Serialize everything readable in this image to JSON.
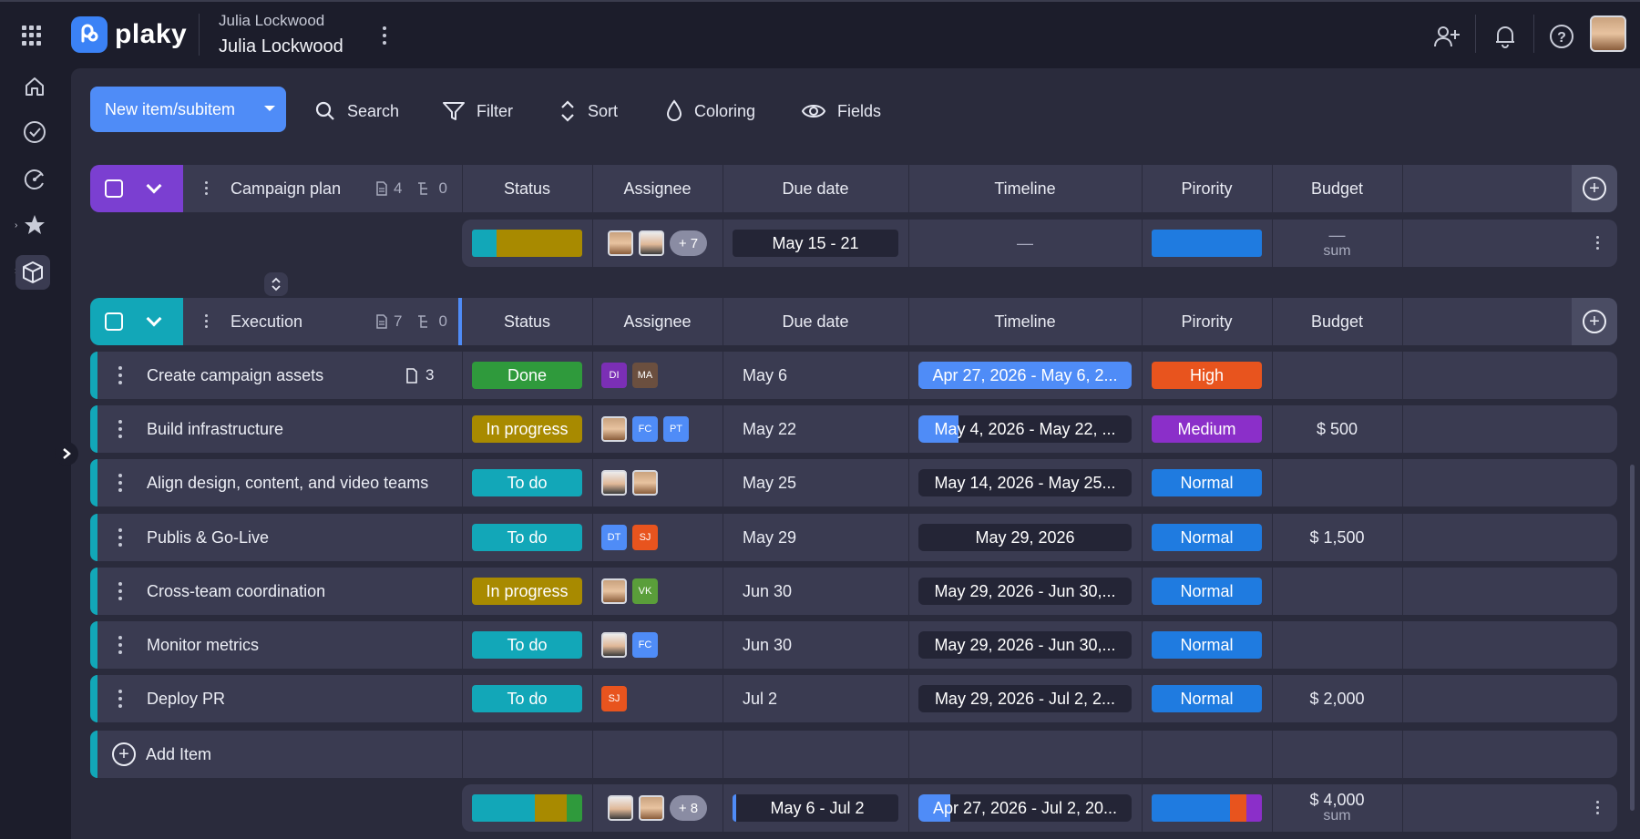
{
  "app": {
    "brand": "plaky",
    "workspace_owner": "Julia Lockwood",
    "board_title": "Julia Lockwood"
  },
  "toolbar": {
    "new_label": "New item/subitem",
    "search_label": "Search",
    "filter_label": "Filter",
    "sort_label": "Sort",
    "coloring_label": "Coloring",
    "fields_label": "Fields"
  },
  "columns": [
    "Status",
    "Assignee",
    "Due date",
    "Timeline",
    "Pirority",
    "Budget"
  ],
  "group1": {
    "name": "Campaign plan",
    "item_count": "4",
    "subitem_count": "0",
    "color": "#7b3fd1",
    "summary": {
      "more": "+ 7",
      "due": "May 15 - 21",
      "timeline": "—",
      "budget_value": "—",
      "budget_label": "sum"
    }
  },
  "group2": {
    "name": "Execution",
    "item_count": "7",
    "subitem_count": "0",
    "color": "#12a7b8",
    "items": [
      {
        "name": "Create campaign assets",
        "files": "3",
        "status": "Done",
        "status_color": "#2f9a3c",
        "assignees": [
          {
            "initials": "DI",
            "color": "#7b2fb5"
          },
          {
            "initials": "MA",
            "color": "#6b4f3f"
          }
        ],
        "due": "May 6",
        "timeline": "Apr 27, 2026 - May 6, 2...",
        "timeline_fill": 1.0,
        "priority": "High",
        "priority_color": "#e8541e",
        "budget": ""
      },
      {
        "name": "Build infrastructure",
        "files": "",
        "status": "In progress",
        "status_color": "#a88a00",
        "assignees": [
          {
            "initials": "",
            "face": true
          },
          {
            "initials": "FC",
            "color": "#4f8cf7"
          },
          {
            "initials": "PT",
            "color": "#4f8cf7"
          }
        ],
        "due": "May 22",
        "timeline": "May 4, 2026 - May 22, ...",
        "timeline_fill": 0.19,
        "priority": "Medium",
        "priority_color": "#8b2fc9",
        "budget": "$ 500"
      },
      {
        "name": "Align design, content, and video teams",
        "files": "",
        "status": "To do",
        "status_color": "#12a7b8",
        "assignees": [
          {
            "initials": "",
            "face2": true
          },
          {
            "initials": "",
            "face": true
          }
        ],
        "due": "May 25",
        "timeline": "May 14, 2026 - May 25...",
        "timeline_fill": 0,
        "priority": "Normal",
        "priority_color": "#1f7be0",
        "budget": ""
      },
      {
        "name": "Publis & Go-Live",
        "files": "",
        "status": "To do",
        "status_color": "#12a7b8",
        "assignees": [
          {
            "initials": "DT",
            "color": "#4f8cf7"
          },
          {
            "initials": "SJ",
            "color": "#e8541e"
          }
        ],
        "due": "May 29",
        "timeline": "May 29, 2026",
        "timeline_fill": 0,
        "priority": "Normal",
        "priority_color": "#1f7be0",
        "budget": "$ 1,500"
      },
      {
        "name": "Cross-team coordination",
        "files": "",
        "status": "In progress",
        "status_color": "#a88a00",
        "assignees": [
          {
            "initials": "",
            "face": true
          },
          {
            "initials": "VK",
            "color": "#5a9e3a"
          }
        ],
        "due": "Jun 30",
        "timeline": "May 29, 2026 - Jun 30,...",
        "timeline_fill": 0,
        "priority": "Normal",
        "priority_color": "#1f7be0",
        "budget": ""
      },
      {
        "name": "Monitor metrics",
        "files": "",
        "status": "To do",
        "status_color": "#12a7b8",
        "assignees": [
          {
            "initials": "",
            "face2": true
          },
          {
            "initials": "FC",
            "color": "#4f8cf7"
          }
        ],
        "due": "Jun 30",
        "timeline": "May 29, 2026 - Jun 30,...",
        "timeline_fill": 0,
        "priority": "Normal",
        "priority_color": "#1f7be0",
        "budget": ""
      },
      {
        "name": "Deploy PR",
        "files": "",
        "status": "To do",
        "status_color": "#12a7b8",
        "assignees": [
          {
            "initials": "SJ",
            "color": "#e8541e"
          }
        ],
        "due": "Jul 2",
        "timeline": "May 29, 2026 - Jul 2, 2...",
        "timeline_fill": 0,
        "priority": "Normal",
        "priority_color": "#1f7be0",
        "budget": "$ 2,000"
      }
    ],
    "add_item_label": "Add Item",
    "summary": {
      "more": "+ 8",
      "due": "May 6 - Jul 2",
      "timeline": "Apr 27, 2026 - Jul 2, 20...",
      "budget_value": "$ 4,000",
      "budget_label": "sum"
    }
  }
}
